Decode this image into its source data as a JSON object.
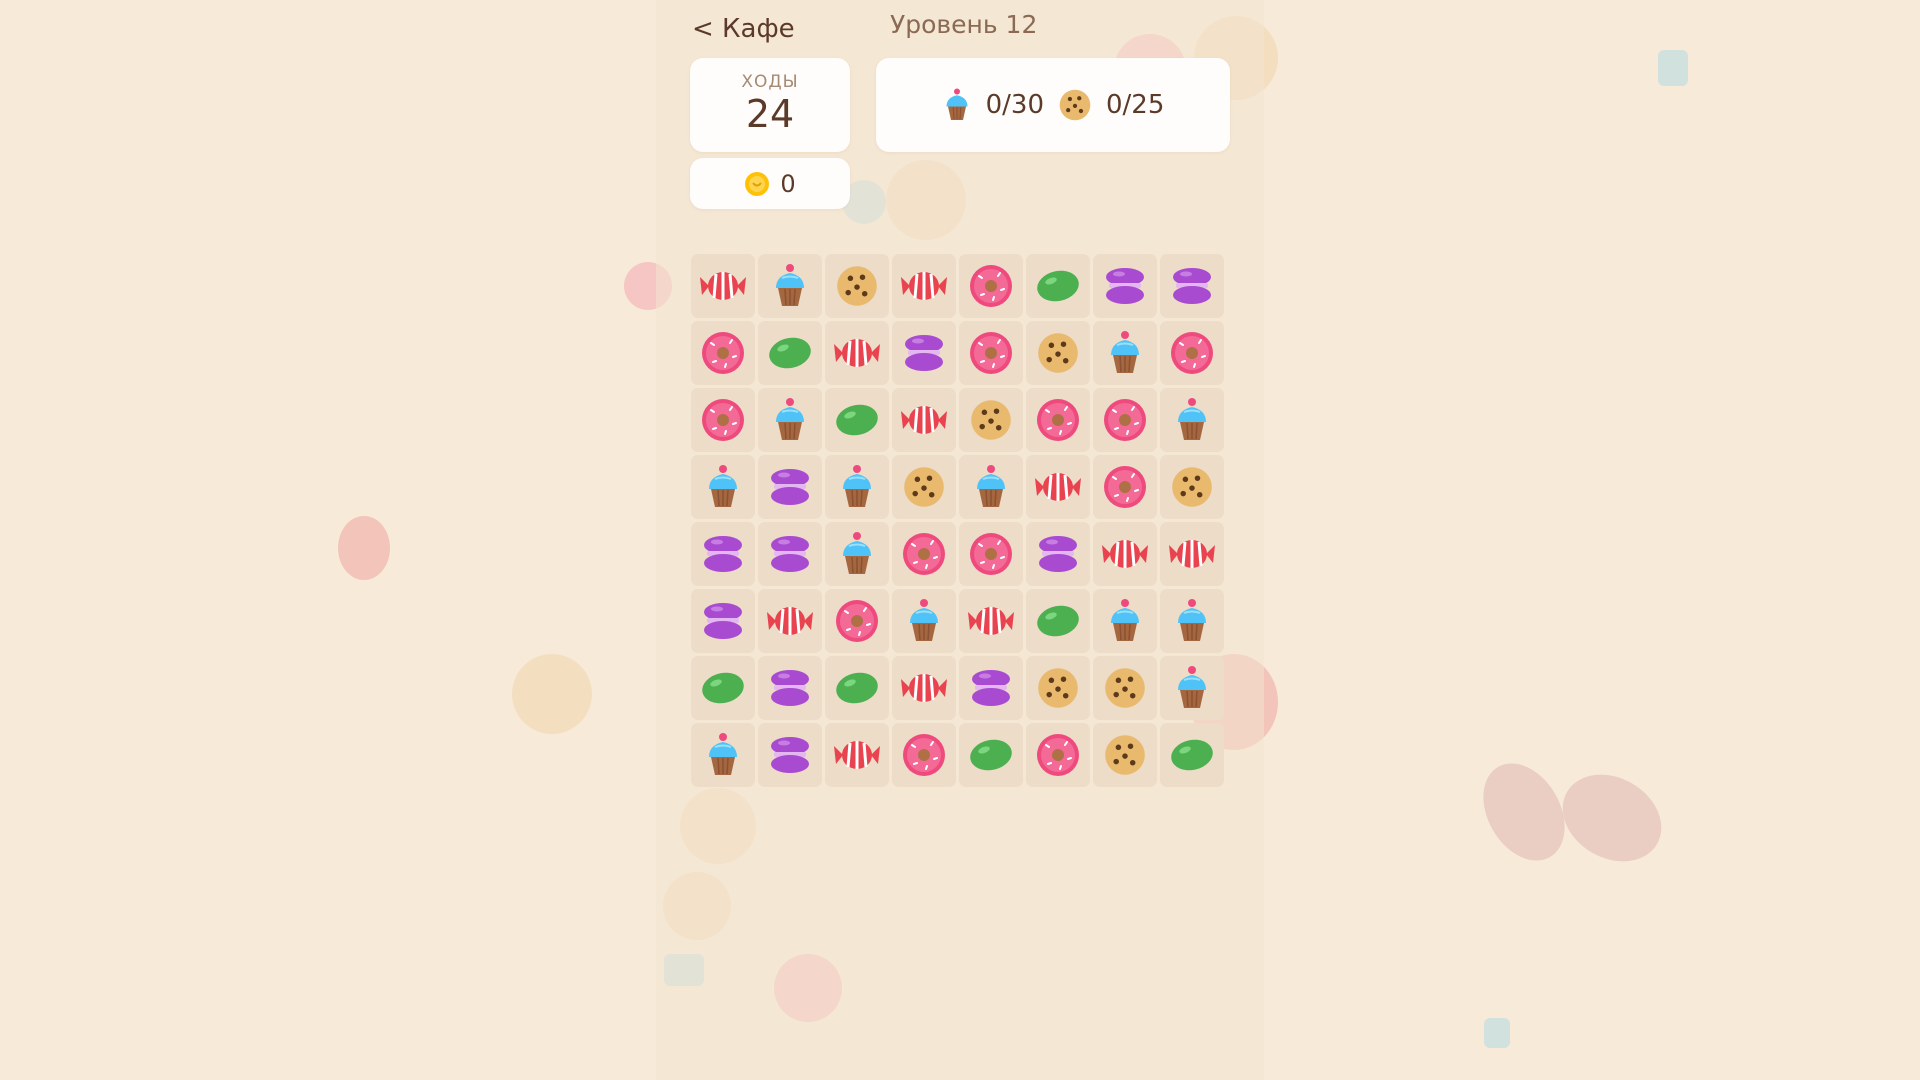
{
  "header": {
    "back_label": "< Кафе",
    "level_title": "Уровень 12"
  },
  "moves": {
    "label": "ХОДЫ",
    "value": "24"
  },
  "coins": {
    "value": "0",
    "icon": "coin-icon"
  },
  "goals": [
    {
      "icon": "cupcake",
      "progress": "0/30"
    },
    {
      "icon": "cookie",
      "progress": "0/25"
    }
  ],
  "colors": {
    "background": "#f7ead8",
    "card": "#fffdfb",
    "cell": "#ecdcc8",
    "candy": "#e8434f",
    "cupcake_frosting": "#4fc3f7",
    "cookie": "#e9b96e",
    "donut": "#ef4a7e",
    "jellybean": "#4caf50",
    "macaron": "#a94bd1",
    "coin": "#ffc107"
  },
  "board": [
    [
      "candy",
      "cupcake",
      "cookie",
      "candy",
      "donut",
      "jellybean",
      "macaron",
      "macaron"
    ],
    [
      "donut",
      "jellybean",
      "candy",
      "macaron",
      "donut",
      "cookie",
      "cupcake",
      "donut"
    ],
    [
      "donut",
      "cupcake",
      "jellybean",
      "candy",
      "cookie",
      "donut",
      "donut",
      "cupcake"
    ],
    [
      "cupcake",
      "macaron",
      "cupcake",
      "cookie",
      "cupcake",
      "candy",
      "donut",
      "cookie"
    ],
    [
      "macaron",
      "macaron",
      "cupcake",
      "donut",
      "donut",
      "macaron",
      "candy",
      "candy"
    ],
    [
      "macaron",
      "candy",
      "donut",
      "cupcake",
      "candy",
      "jellybean",
      "cupcake",
      "cupcake"
    ],
    [
      "jellybean",
      "macaron",
      "jellybean",
      "candy",
      "macaron",
      "cookie",
      "cookie",
      "cupcake"
    ],
    [
      "cupcake",
      "macaron",
      "candy",
      "donut",
      "jellybean",
      "donut",
      "cookie",
      "jellybean"
    ]
  ]
}
